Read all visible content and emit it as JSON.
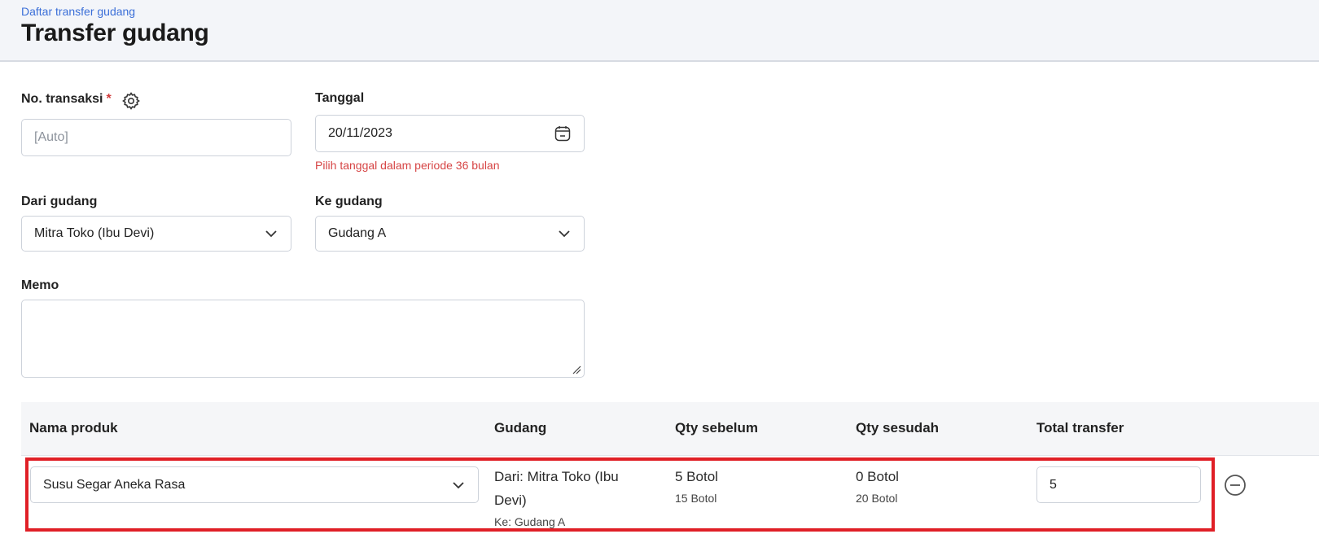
{
  "header": {
    "breadcrumb": "Daftar transfer gudang",
    "title": "Transfer gudang"
  },
  "form": {
    "no_transaksi": {
      "label": "No. transaksi",
      "required_mark": "*",
      "placeholder": "[Auto]",
      "value": ""
    },
    "tanggal": {
      "label": "Tanggal",
      "value": "20/11/2023",
      "hint": "Pilih tanggal dalam periode 36 bulan"
    },
    "dari_gudang": {
      "label": "Dari gudang",
      "value": "Mitra Toko (Ibu Devi)"
    },
    "ke_gudang": {
      "label": "Ke gudang",
      "value": "Gudang A"
    },
    "memo": {
      "label": "Memo",
      "value": ""
    }
  },
  "table": {
    "headers": {
      "nama_produk": "Nama produk",
      "gudang": "Gudang",
      "qty_sebelum": "Qty sebelum",
      "qty_sesudah": "Qty sesudah",
      "total_transfer": "Total transfer"
    },
    "rows": [
      {
        "product": "Susu Segar Aneka Rasa",
        "gudang_dari_line1": "Dari: Mitra Toko (Ibu",
        "gudang_dari_line2": "Devi)",
        "gudang_ke": "Ke: Gudang A",
        "qty_sebelum_main": "5 Botol",
        "qty_sebelum_sub": "15 Botol",
        "qty_sesudah_main": "0 Botol",
        "qty_sesudah_sub": "20 Botol",
        "total_transfer": "5"
      }
    ]
  },
  "colors": {
    "accent_link": "#3b6fd8",
    "error": "#d64545",
    "highlight_border": "#e01f26"
  },
  "icons": [
    "settings-gear-icon",
    "calendar-icon",
    "chevron-down-icon",
    "remove-row-icon",
    "resize-handle-icon"
  ]
}
